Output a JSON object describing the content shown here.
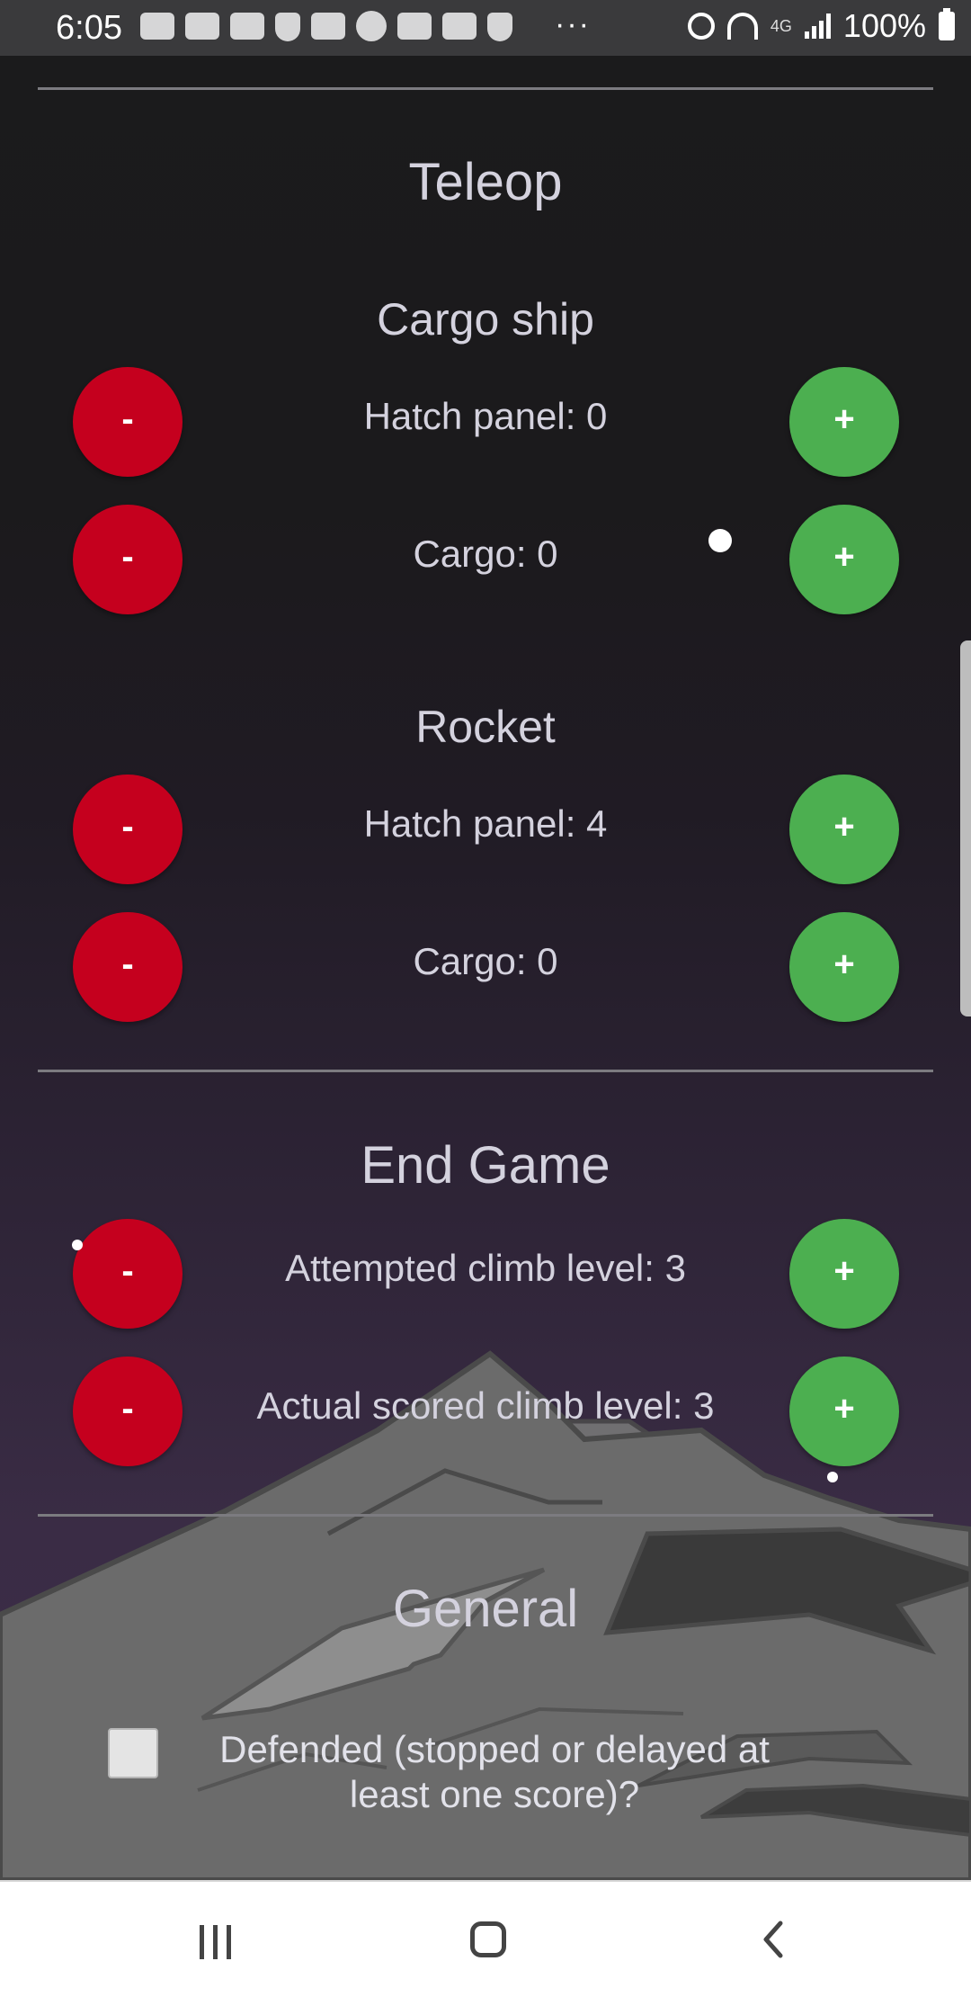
{
  "status_bar": {
    "time": "6:05",
    "more": "···",
    "network": "4G",
    "battery": "100%",
    "icons": [
      "outlook-icon",
      "outlook-icon",
      "outlook-icon",
      "nfl-icon",
      "ge-icon",
      "browser-icon",
      "outlook-icon",
      "ge-icon",
      "nfl-icon"
    ]
  },
  "teleop": {
    "title": "Teleop",
    "cargo_ship": {
      "title": "Cargo ship",
      "hatch_panel": "Hatch panel: 0",
      "cargo": "Cargo: 0"
    },
    "rocket": {
      "title": "Rocket",
      "hatch_panel": "Hatch panel: 4",
      "cargo": "Cargo: 0"
    }
  },
  "end_game": {
    "title": "End Game",
    "attempted_climb": "Attempted climb level: 3",
    "actual_climb": "Actual scored climb level: 3"
  },
  "general": {
    "title": "General",
    "defended_label": "Defended (stopped or delayed at least one score)?",
    "defended_checked": false
  },
  "buttons": {
    "minus": "-",
    "plus": "+"
  },
  "colors": {
    "minus_button": "#c5001e",
    "plus_button": "#4caf50",
    "text": "#d4d2de",
    "divider": "#7c7b80"
  }
}
